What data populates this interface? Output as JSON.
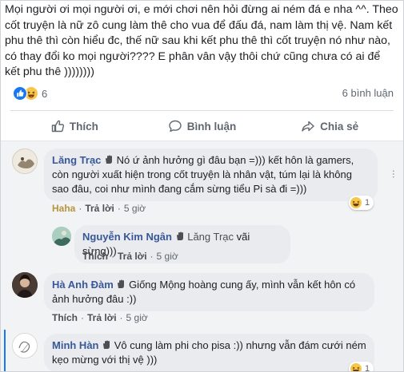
{
  "post": {
    "text": "Mọi người ơi mọi người ơi, e mới chơi nên hỏi đừng ai ném đá e nha ^^. Theo cốt truyện là nữ zô cung làm thê cho vua để đấu đá, nam làm thị vệ. Nam kết phu thê thì còn hiểu đc, thế nữ sau khi kết phu thê thì cốt truyện nó như nào, có thay đổi ko mọi người???? E phân vân vậy thôi chứ cũng chưa có ai để kết phu thê ))))))))",
    "reaction_count": "6",
    "comment_count": "6 bình luận"
  },
  "actions": {
    "like": "Thích",
    "comment": "Bình luận",
    "share": "Chia sẻ"
  },
  "comments": [
    {
      "name": "Lăng Trạc",
      "text": "Nó ứ ảnh hưởng gì đâu bạn =))) kết hôn là gamers, còn người xuất hiện trong cốt truyện là nhân vật, túm lại là không sao đâu, coi như mình đang cắm sừng tiểu Pi sà đi =)))",
      "reaction_label": "Haha",
      "reply": "Trả lời",
      "time": "5 giờ",
      "reaction_count": "1"
    },
    {
      "name": "Nguyễn Kim Ngân",
      "mention": "Lăng Trạc",
      "text": "vãi sừng)))",
      "like": "Thích",
      "reply": "Trả lời",
      "time": "5 giờ"
    },
    {
      "name": "Hà Anh Đàm",
      "text": "Giống Mộng hoàng cung ấy, mình vẫn kết hôn có ảnh hưởng đâu :))",
      "like": "Thích",
      "reply": "Trả lời",
      "time": "5 giờ"
    },
    {
      "name": "Minh Hàn",
      "text": "Vô cung làm phi cho pisa :)) nhưng vẫn đám cưới ném kẹo mừng với thị vệ )))",
      "reaction_count": "1"
    }
  ],
  "colors": {
    "name_link": "#385898",
    "haha_label": "#b8933d",
    "bubble": "#e9ebee",
    "like_blue": "#1877f2"
  }
}
